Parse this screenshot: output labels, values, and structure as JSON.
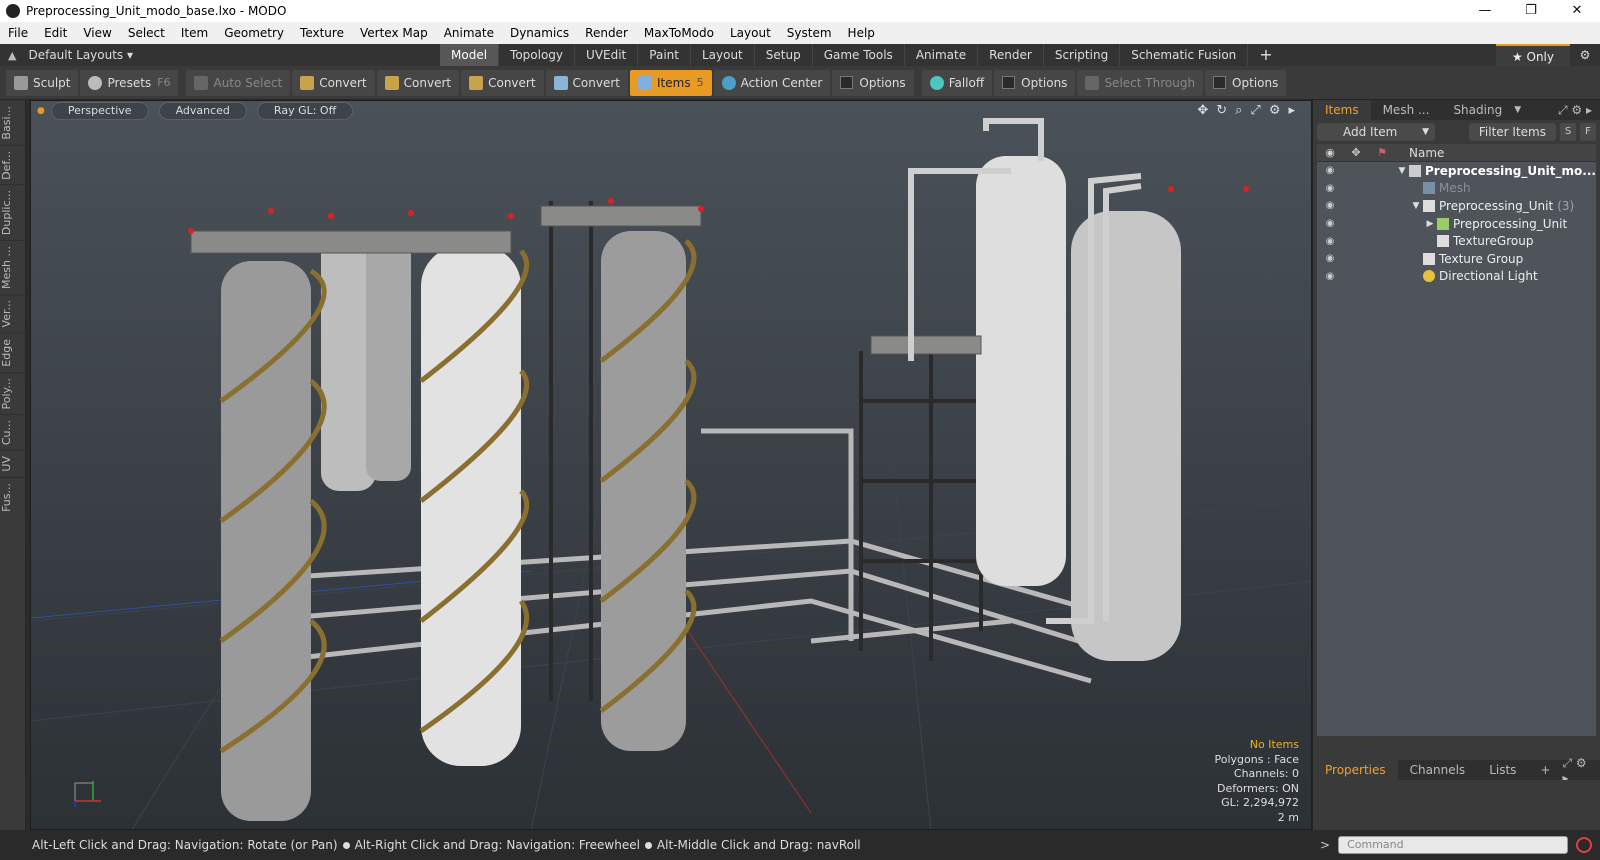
{
  "window": {
    "title": "Preprocessing_Unit_modo_base.lxo - MODO",
    "min": "—",
    "max": "❐",
    "close": "✕"
  },
  "menu": [
    "File",
    "Edit",
    "View",
    "Select",
    "Item",
    "Geometry",
    "Texture",
    "Vertex Map",
    "Animate",
    "Dynamics",
    "Render",
    "MaxToModo",
    "Layout",
    "System",
    "Help"
  ],
  "layouts": {
    "label": "Default Layouts ▾"
  },
  "tabs": [
    "Model",
    "Topology",
    "UVEdit",
    "Paint",
    "Layout",
    "Setup",
    "Game Tools",
    "Animate",
    "Render",
    "Scripting",
    "Schematic Fusion",
    "+"
  ],
  "only": "★  Only",
  "toolbar": {
    "sculpt": "Sculpt",
    "presets": "Presets",
    "presets_key": "F6",
    "auto_select": "Auto Select",
    "convert": "Convert",
    "items": "Items",
    "items_key": "5",
    "action_center": "Action Center",
    "options": "Options",
    "falloff": "Falloff",
    "select_through": "Select Through"
  },
  "lefttabs": [
    "Basi...",
    "Def...",
    "Duplic...",
    "Mesh ...",
    "Ver...",
    "Edge",
    "Poly...",
    "Cu...",
    "UV",
    "Fus..."
  ],
  "viewport": {
    "perspective": "Perspective",
    "advanced": "Advanced",
    "raygl": "Ray GL: Off",
    "info": {
      "no_items": "No Items",
      "polygons": "Polygons : Face",
      "channels": "Channels: 0",
      "deformers": "Deformers: ON",
      "gl": "GL: 2,294,972",
      "scale": "2 m"
    }
  },
  "panel": {
    "tabs": [
      "Items",
      "Mesh ...",
      "Shading"
    ],
    "add_item": "Add Item",
    "filter": "Filter Items",
    "s": "S",
    "f": "F",
    "name_col": "Name",
    "tree": [
      {
        "label": "Preprocessing_Unit_mo...",
        "arrow": "▼",
        "indent": 0
      },
      {
        "label": "Mesh",
        "arrow": "",
        "indent": 1
      },
      {
        "label": "Preprocessing_Unit",
        "count": "(3)",
        "arrow": "▼",
        "indent": 1
      },
      {
        "label": "Preprocessing_Unit",
        "arrow": "▶",
        "indent": 2
      },
      {
        "label": "TextureGroup",
        "arrow": "",
        "indent": 2
      },
      {
        "label": "Texture Group",
        "arrow": "",
        "indent": 1
      },
      {
        "label": "Directional Light",
        "arrow": "",
        "indent": 1
      }
    ]
  },
  "props": {
    "tabs": [
      "Properties",
      "Channels",
      "Lists",
      "+"
    ]
  },
  "status": {
    "hint1": "Alt-Left Click and Drag: Navigation: Rotate (or Pan)",
    "hint2": "Alt-Right Click and Drag: Navigation: Freewheel",
    "hint3": "Alt-Middle Click and Drag: navRoll"
  },
  "command": {
    "placeholder": "Command",
    "prompt": ">"
  },
  "colors": {
    "accent": "#e89a23",
    "items_active": "#f0a030"
  }
}
